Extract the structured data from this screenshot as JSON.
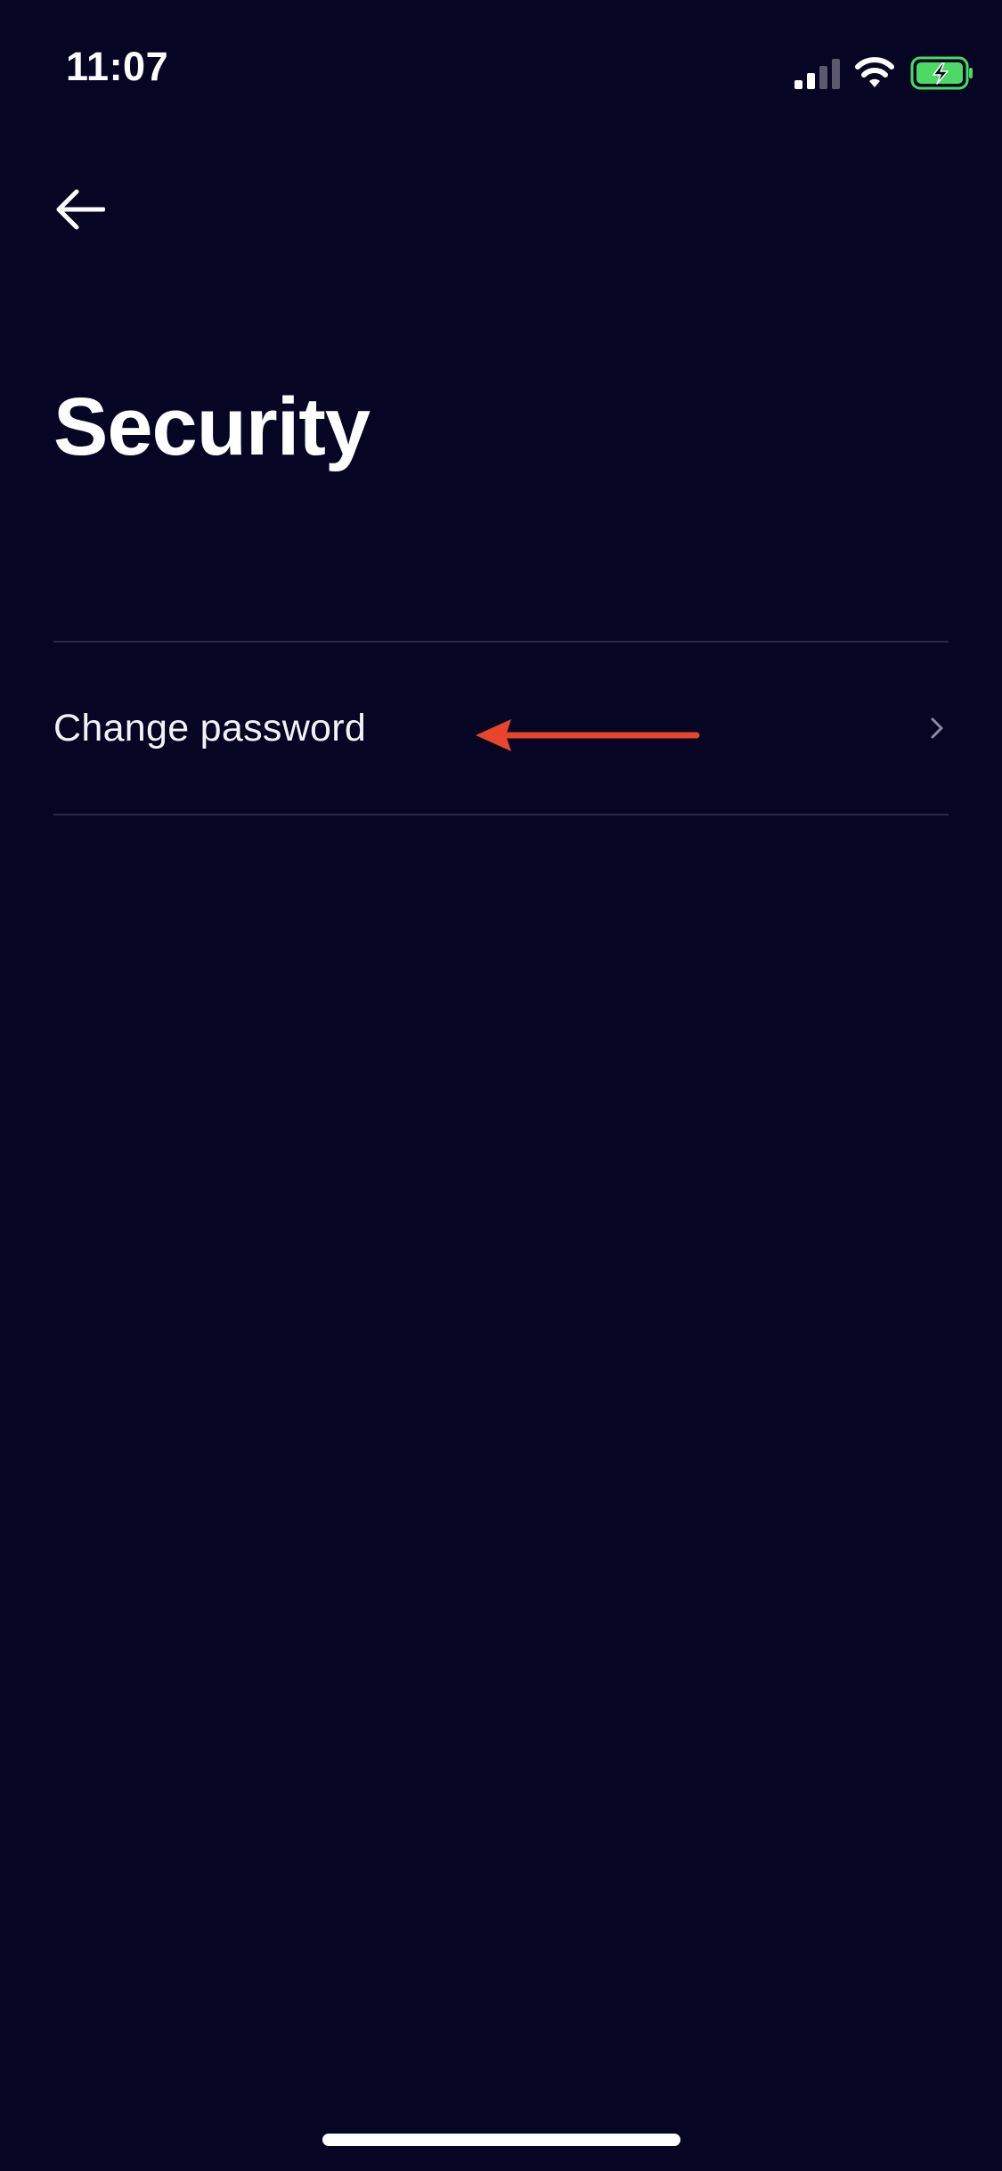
{
  "status_bar": {
    "time": "11:07",
    "icons": [
      "signal-icon",
      "wifi-icon",
      "battery-charging-icon"
    ],
    "battery_color": "#4cd964"
  },
  "header": {
    "back_icon": "arrow-left-icon",
    "title": "Security"
  },
  "settings": {
    "items": [
      {
        "label": "Change password",
        "icon": "chevron-right-icon"
      }
    ]
  },
  "annotation": {
    "type": "arrow-left",
    "color": "#e8452c"
  },
  "colors": {
    "background": "#070524",
    "divider": "#2a2845",
    "text": "#ffffff"
  }
}
